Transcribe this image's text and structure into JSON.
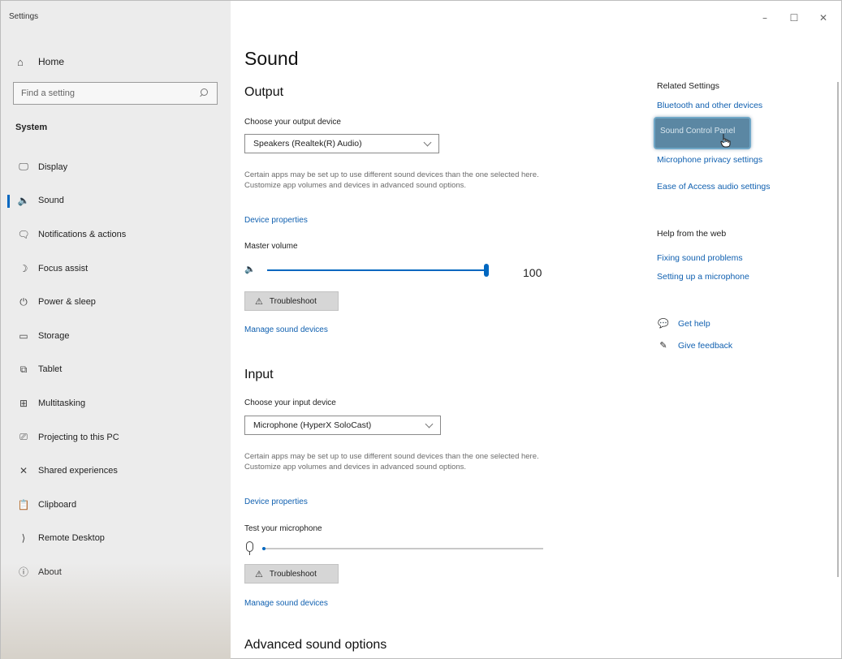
{
  "window": {
    "title": "Settings",
    "controls": {
      "minimize": "–",
      "maximize": "☐",
      "close": "✕"
    }
  },
  "sidebar": {
    "home_label": "Home",
    "search_placeholder": "Find a setting",
    "section_label": "System",
    "items": [
      {
        "label": "Display",
        "icon": "display-icon",
        "glyph": "🖵",
        "active": false
      },
      {
        "label": "Sound",
        "icon": "speaker-icon",
        "glyph": "🔈",
        "active": true
      },
      {
        "label": "Notifications & actions",
        "icon": "notifications-icon",
        "glyph": "🗨",
        "active": false
      },
      {
        "label": "Focus assist",
        "icon": "moon-icon",
        "glyph": "☽",
        "active": false
      },
      {
        "label": "Power & sleep",
        "icon": "power-icon",
        "glyph": "⏻",
        "active": false
      },
      {
        "label": "Storage",
        "icon": "storage-icon",
        "glyph": "▭",
        "active": false
      },
      {
        "label": "Tablet",
        "icon": "tablet-icon",
        "glyph": "⧉",
        "active": false
      },
      {
        "label": "Multitasking",
        "icon": "multitasking-icon",
        "glyph": "⊞",
        "active": false
      },
      {
        "label": "Projecting to this PC",
        "icon": "projecting-icon",
        "glyph": "⎚",
        "active": false
      },
      {
        "label": "Shared experiences",
        "icon": "shared-experiences-icon",
        "glyph": "✕",
        "active": false
      },
      {
        "label": "Clipboard",
        "icon": "clipboard-icon",
        "glyph": "📋",
        "active": false
      },
      {
        "label": "Remote Desktop",
        "icon": "remote-desktop-icon",
        "glyph": "⟩",
        "active": false
      },
      {
        "label": "About",
        "icon": "info-icon",
        "glyph": "ⓘ",
        "active": false
      }
    ]
  },
  "main": {
    "title": "Sound",
    "output": {
      "heading": "Output",
      "device_label": "Choose your output device",
      "device_value": "Speakers (Realtek(R) Audio)",
      "description": "Certain apps may be set up to use different sound devices than the one selected here. Customize app volumes and devices in advanced sound options.",
      "device_properties": "Device properties",
      "master_volume_label": "Master volume",
      "master_volume": 100,
      "master_volume_text": "100",
      "troubleshoot": "Troubleshoot",
      "manage_devices": "Manage sound devices"
    },
    "input": {
      "heading": "Input",
      "device_label": "Choose your input device",
      "device_value": "Microphone (HyperX SoloCast)",
      "description": "Certain apps may be set up to use different sound devices than the one selected here. Customize app volumes and devices in advanced sound options.",
      "device_properties": "Device properties",
      "test_label": "Test your microphone",
      "mic_level": 0.01,
      "troubleshoot": "Troubleshoot",
      "manage_devices": "Manage sound devices"
    },
    "advanced_heading": "Advanced sound options"
  },
  "right": {
    "related_heading": "Related Settings",
    "related_links": {
      "bluetooth": "Bluetooth and other devices",
      "sound_control_panel": "Sound Control Panel",
      "mic_privacy": "Microphone privacy settings",
      "ease_of_access": "Ease of Access audio settings"
    },
    "help_heading": "Help from the web",
    "help_links": {
      "fixing": "Fixing sound problems",
      "setting_up_mic": "Setting up a microphone"
    },
    "get_help": "Get help",
    "give_feedback": "Give feedback"
  },
  "colors": {
    "accent": "#0067c0",
    "link": "#1060b0",
    "sidebar_bg": "#ececec"
  }
}
